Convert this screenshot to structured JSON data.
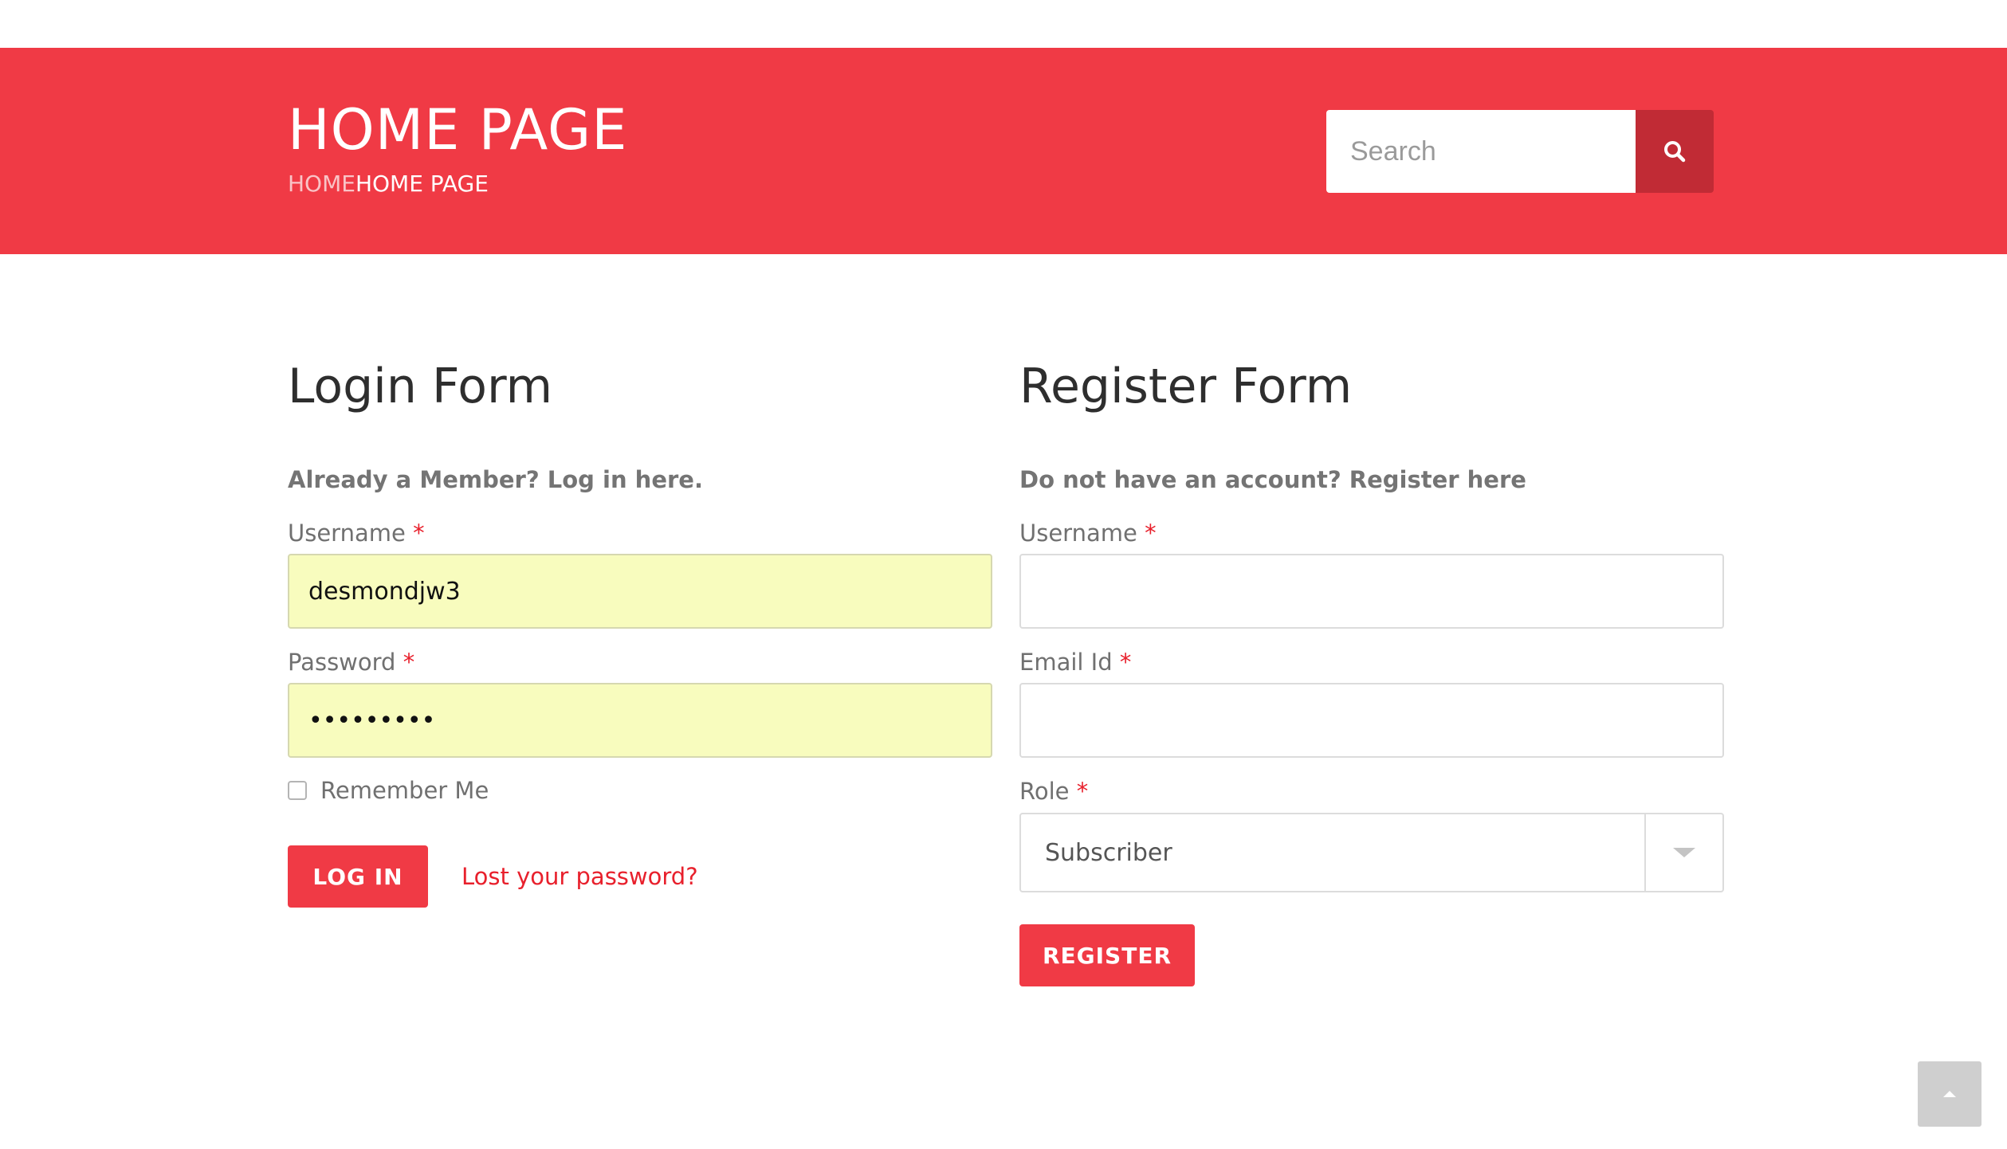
{
  "header": {
    "title": "HOME PAGE",
    "breadcrumb": {
      "home": "HOME",
      "current": "HOME PAGE"
    },
    "search": {
      "placeholder": "Search",
      "icon": "search-icon"
    }
  },
  "login": {
    "title": "Login Form",
    "intro": "Already a Member? Log in here.",
    "username_label": "Username",
    "username_value": "desmondjw3",
    "password_label": "Password",
    "password_value": "•••••••••",
    "required_mark": "*",
    "remember_label": "Remember Me",
    "remember_checked": false,
    "submit_label": "LOG IN",
    "lost_password_link": "Lost your password?"
  },
  "register": {
    "title": "Register Form",
    "intro": "Do not have an account? Register here",
    "username_label": "Username",
    "username_value": "",
    "email_label": "Email Id",
    "email_value": "",
    "role_label": "Role",
    "role_value": "Subscriber",
    "required_mark": "*",
    "submit_label": "REGISTER"
  },
  "colors": {
    "accent": "#f03a45",
    "accent_dark": "#c12b35",
    "autofill": "#f8fcbe"
  },
  "scroll_top": {
    "icon": "chevron-up-icon"
  }
}
